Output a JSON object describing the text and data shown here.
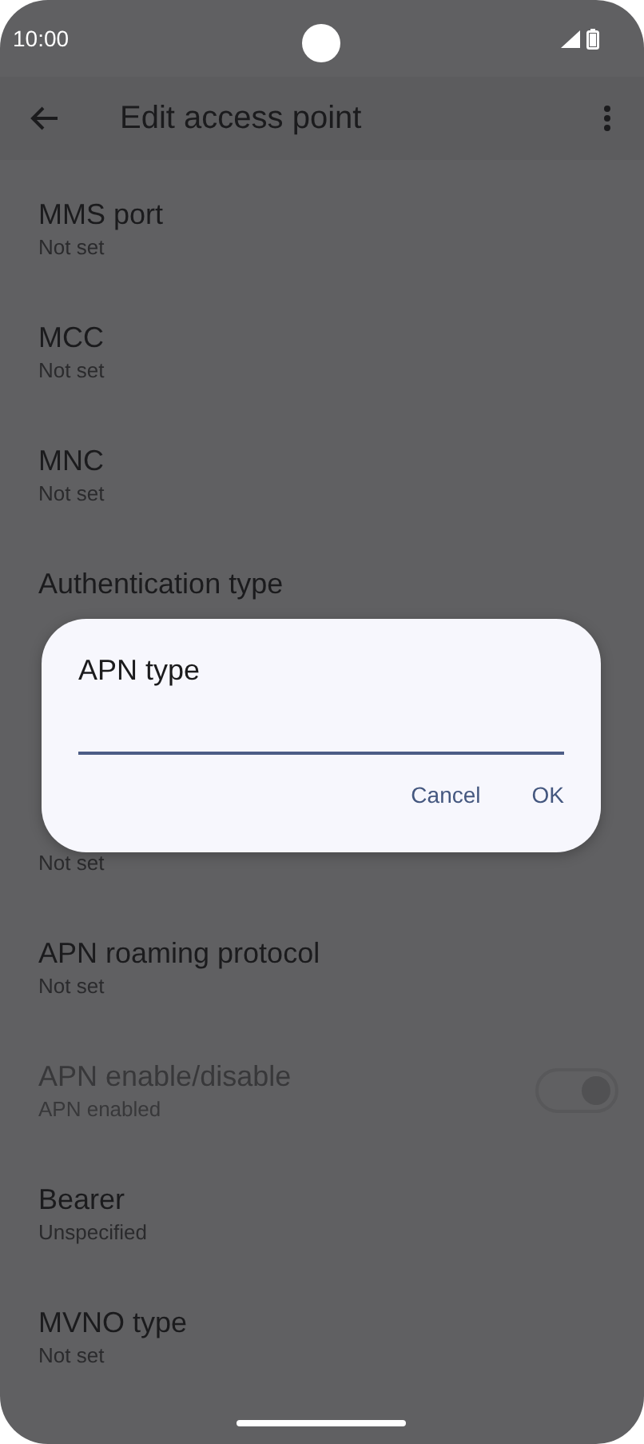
{
  "status_bar": {
    "time": "10:00"
  },
  "toolbar": {
    "title": "Edit access point"
  },
  "items": [
    {
      "kind": "text",
      "title": "MMS port",
      "summary": "Not set"
    },
    {
      "kind": "text",
      "title": "MCC",
      "summary": "Not set"
    },
    {
      "kind": "text",
      "title": "MNC",
      "summary": "Not set"
    },
    {
      "kind": "text",
      "title": "Authentication type"
    },
    {
      "kind": "hidden"
    },
    {
      "kind": "text",
      "summary": "Not set"
    },
    {
      "kind": "text",
      "title": "APN roaming protocol",
      "summary": "Not set"
    },
    {
      "kind": "switch",
      "title": "APN enable/disable",
      "summary": "APN enabled",
      "disabled": true,
      "on": true
    },
    {
      "kind": "text",
      "title": "Bearer",
      "summary": "Unspecified"
    },
    {
      "kind": "text",
      "title": "MVNO type",
      "summary": "Not set"
    }
  ],
  "dialog": {
    "title": "APN type",
    "buttons": [
      "Cancel",
      "OK"
    ]
  }
}
